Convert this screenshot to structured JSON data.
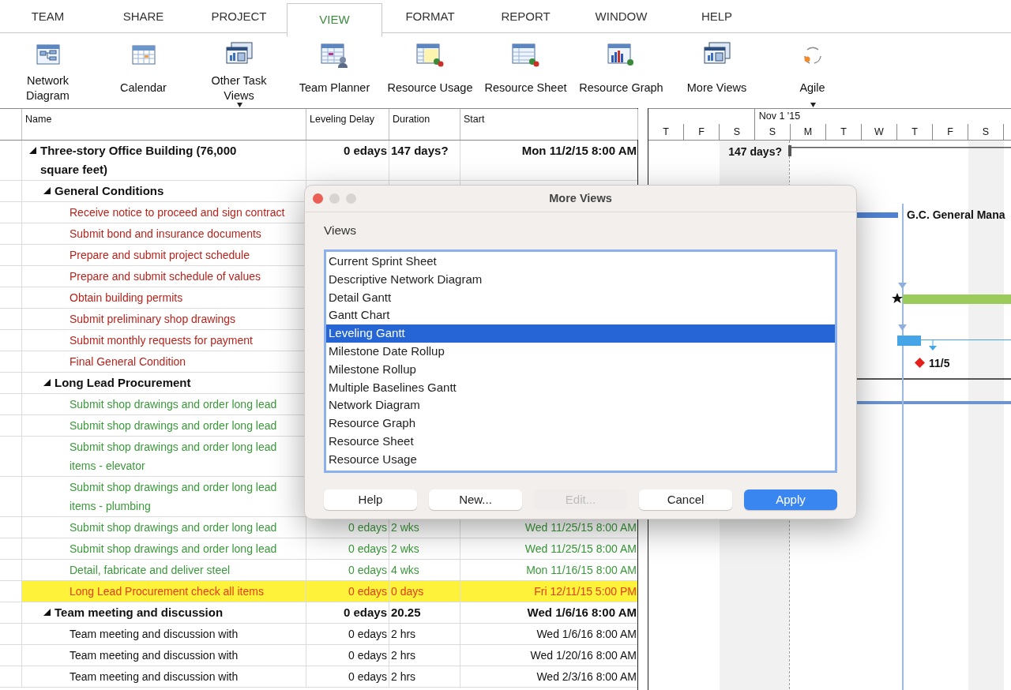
{
  "tabs": [
    {
      "label": "TEAM",
      "selected": false
    },
    {
      "label": "SHARE",
      "selected": false
    },
    {
      "label": "PROJECT",
      "selected": false
    },
    {
      "label": "VIEW",
      "selected": true
    },
    {
      "label": "FORMAT",
      "selected": false
    },
    {
      "label": "REPORT",
      "selected": false
    },
    {
      "label": "WINDOW",
      "selected": false
    },
    {
      "label": "HELP",
      "selected": false
    }
  ],
  "ribbon": [
    {
      "kind": "network",
      "label": "Network Diagram",
      "caret": false
    },
    {
      "kind": "calendar",
      "label": "Calendar",
      "caret": false
    },
    {
      "kind": "views",
      "label": "Other Task Views",
      "caret": true
    },
    {
      "kind": "team",
      "label": "Team Planner",
      "caret": false
    },
    {
      "kind": "usage",
      "label": "Resource Usage",
      "caret": false
    },
    {
      "kind": "sheet",
      "label": "Resource Sheet",
      "caret": false
    },
    {
      "kind": "graph",
      "label": "Resource Graph",
      "caret": false
    },
    {
      "kind": "more",
      "label": "More Views",
      "caret": false
    },
    {
      "kind": "agile",
      "label": "Agile",
      "caret": true
    }
  ],
  "table": {
    "columns": [
      "Name",
      "Leveling Delay",
      "Duration",
      "Start"
    ],
    "tasks": [
      {
        "name": "Three-story Office Building (76,000 square feet)",
        "expanded": true,
        "leveling_delay": "0 edays",
        "duration": "147 days?",
        "start": "Mon 11/2/15 8:00 AM",
        "children": [
          {
            "name": "General Conditions",
            "expanded": true,
            "children": [
              {
                "name": "Receive notice to proceed and sign contract",
                "color": "#b8231c"
              },
              {
                "name": "Submit bond and insurance documents",
                "color": "#b8231c"
              },
              {
                "name": "Prepare and submit project schedule",
                "color": "#b8231c"
              },
              {
                "name": "Prepare and submit schedule of values",
                "color": "#b8231c"
              },
              {
                "name": "Obtain building permits",
                "color": "#b8231c"
              },
              {
                "name": "Submit preliminary shop drawings",
                "color": "#b8231c"
              },
              {
                "name": "Submit monthly requests for payment",
                "color": "#b8231c"
              },
              {
                "name": "Final General Condition",
                "color": "#b8231c"
              }
            ]
          },
          {
            "name": "Long Lead Procurement",
            "expanded": true,
            "children": [
              {
                "name": "Submit shop drawings and order long lead",
                "color": "#3a993a",
                "highlighted": false
              },
              {
                "name": "Submit shop drawings and order long lead",
                "color": "#3a993a",
                "highlighted": false
              },
              {
                "name": "Submit shop drawings and order long lead items - elevator",
                "color": "#3a993a",
                "highlighted": false
              },
              {
                "name": "Submit shop drawings and order long lead items - plumbing",
                "color": "#3a993a",
                "highlighted": false
              },
              {
                "name": "Submit shop drawings and order long lead",
                "color": "#3a993a",
                "highlighted": false,
                "leveling_delay": "0 edays",
                "duration": "2 wks",
                "start": "Wed 11/25/15 8:00 AM"
              },
              {
                "name": "Submit shop drawings and order long lead",
                "color": "#3a993a",
                "highlighted": false,
                "leveling_delay": "0 edays",
                "duration": "2 wks",
                "start": "Wed 11/25/15 8:00 AM"
              },
              {
                "name": "Detail, fabricate and deliver steel",
                "color": "#3a993a",
                "highlighted": false,
                "leveling_delay": "0 edays",
                "duration": "4 wks",
                "start": "Mon 11/16/15 8:00 AM"
              },
              {
                "name": "Long Lead Procurement check all items",
                "highlighted": true,
                "leveling_delay": "0 edays",
                "duration": "0 days",
                "start": "Fri 12/11/15 5:00 PM"
              }
            ]
          },
          {
            "name": "Team meeting and discussion",
            "expanded": true,
            "leveling_delay": "0 edays",
            "duration": "20.25",
            "start": "Wed 1/6/16 8:00 AM",
            "children": [
              {
                "name": "Team meeting and discussion with",
                "leveling_delay": "0 edays",
                "duration": "2 hrs",
                "start": "Wed 1/6/16 8:00 AM"
              },
              {
                "name": "Team meeting and discussion with",
                "leveling_delay": "0 edays",
                "duration": "2 hrs",
                "start": "Wed 1/20/16 8:00 AM"
              },
              {
                "name": "Team meeting and discussion with",
                "leveling_delay": "0 edays",
                "duration": "2 hrs",
                "start": "Wed 2/3/16 8:00 AM"
              }
            ]
          }
        ]
      }
    ]
  },
  "gantt": {
    "month_label": "Nov 1 '15",
    "days": [
      "T",
      "F",
      "S",
      "S",
      "M",
      "T",
      "W",
      "T",
      "F",
      "S"
    ],
    "summary_label": "147 days?",
    "bar_label": "G.C. General Mana",
    "milestone_label": "11/5"
  },
  "dialog": {
    "title": "More Views",
    "list_label": "Views",
    "views": [
      {
        "label": "Current Sprint Sheet",
        "selected": false
      },
      {
        "label": "Descriptive Network Diagram",
        "selected": false
      },
      {
        "label": "Detail Gantt",
        "selected": false
      },
      {
        "label": "Gantt Chart",
        "selected": false
      },
      {
        "label": "Leveling Gantt",
        "selected": true
      },
      {
        "label": "Milestone Date Rollup",
        "selected": false
      },
      {
        "label": "Milestone Rollup",
        "selected": false
      },
      {
        "label": "Multiple Baselines Gantt",
        "selected": false
      },
      {
        "label": "Network Diagram",
        "selected": false
      },
      {
        "label": "Resource Graph",
        "selected": false
      },
      {
        "label": "Resource Sheet",
        "selected": false
      },
      {
        "label": "Resource Usage",
        "selected": false
      }
    ],
    "buttons": [
      {
        "label": "Help",
        "disabled": false,
        "default": false
      },
      {
        "label": "New...",
        "disabled": false,
        "default": false
      },
      {
        "label": "Edit...",
        "disabled": true,
        "default": false
      },
      {
        "label": "Cancel",
        "disabled": false,
        "default": false
      },
      {
        "label": "Apply",
        "disabled": false,
        "default": true
      }
    ]
  }
}
